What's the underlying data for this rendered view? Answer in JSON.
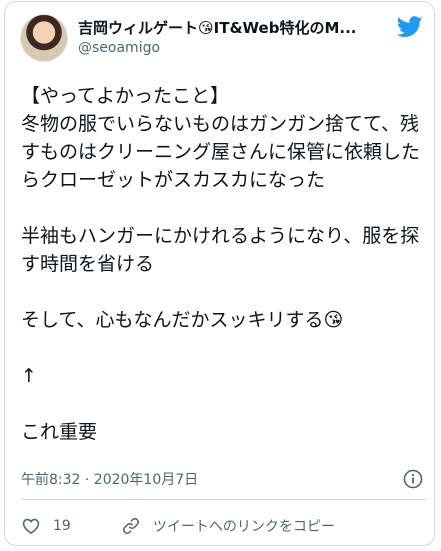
{
  "author": {
    "name": "吉岡ウィルゲート😘IT&Web特化のM...",
    "handle": "@seoamigo"
  },
  "tweet": {
    "text": "【やってよかったこと】\n冬物の服でいらないものはガンガン捨てて、残すものはクリーニング屋さんに保管に依頼したらクローゼットがスカスカになった\n\n半袖もハンガーにかけれるようになり、服を探す時間を省ける\n\nそして、心もなんだかスッキリする😘\n\n↑\n\nこれ重要",
    "timestamp": "午前8:32 · 2020年10月7日"
  },
  "actions": {
    "like_count": "19",
    "copy_link_label": "ツイートへのリンクをコピー"
  },
  "icons": {
    "brand": "twitter-bird-icon",
    "info": "info-icon",
    "like": "heart-icon",
    "copy": "link-icon"
  },
  "colors": {
    "twitter_blue": "#1d9bf0",
    "secondary_text": "#536471"
  }
}
